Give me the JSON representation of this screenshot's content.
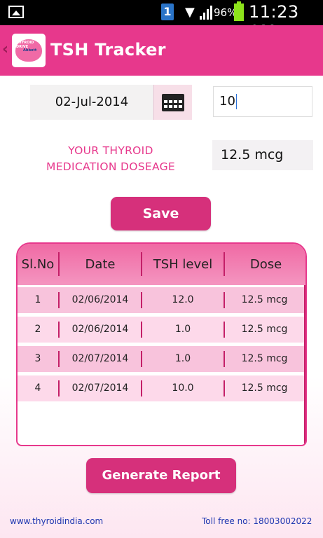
{
  "status_bar": {
    "notification_count": "1",
    "battery_percent": "96%",
    "time": "11:23 AM",
    "icons": [
      "image-icon",
      "wifi-icon",
      "signal-icon",
      "battery-icon"
    ]
  },
  "app_bar": {
    "title": "TSH Tracker",
    "logo_text_line1": "THYROID DRIVE",
    "logo_text_line2": "Abbott",
    "accent_color": "#e7388c"
  },
  "form": {
    "date_value": "02-Jul-2014",
    "tsh_value": "10",
    "medication_label_line1": "YOUR THYROID",
    "medication_label_line2": "MEDICATION DOSEAGE",
    "dose_value": "12.5 mcg",
    "save_label": "Save"
  },
  "table": {
    "headers": [
      "Sl.No",
      "Date",
      "TSH level",
      "Dose"
    ],
    "rows": [
      {
        "sl": "1",
        "date": "02/06/2014",
        "tsh": "12.0",
        "dose": "12.5 mcg"
      },
      {
        "sl": "2",
        "date": "02/06/2014",
        "tsh": "1.0",
        "dose": "12.5 mcg"
      },
      {
        "sl": "3",
        "date": "02/07/2014",
        "tsh": "1.0",
        "dose": "12.5 mcg"
      },
      {
        "sl": "4",
        "date": "02/07/2014",
        "tsh": "10.0",
        "dose": "12.5 mcg"
      }
    ],
    "row_colors": [
      "#f8c3dc",
      "#fdd9ea",
      "#f8c3dc",
      "#fdd9ea"
    ]
  },
  "actions": {
    "generate_report_label": "Generate Report"
  },
  "footer": {
    "website": "www.thyroidindia.com",
    "toll_free": "Toll free no: 18003002022"
  }
}
